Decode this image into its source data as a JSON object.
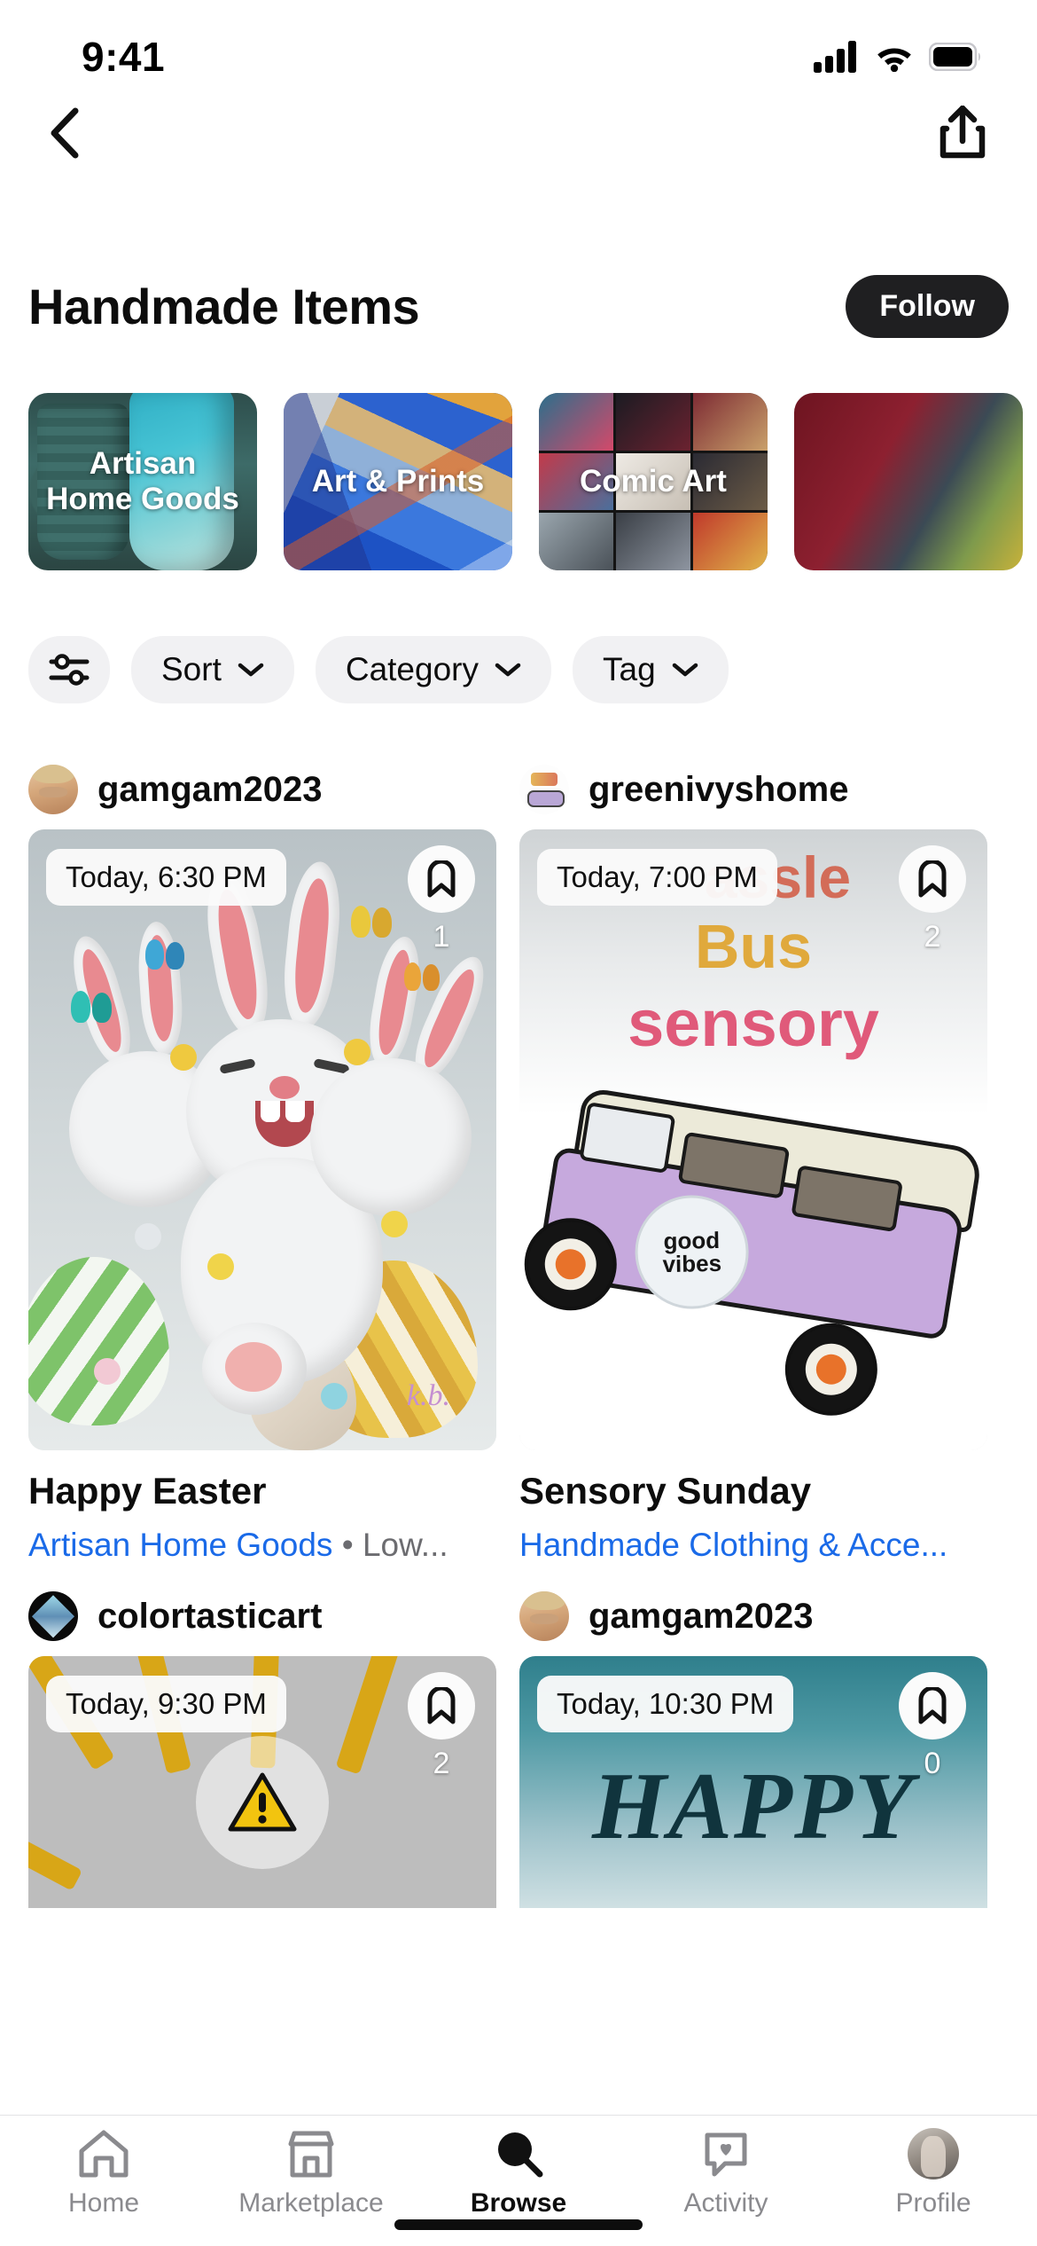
{
  "status_bar": {
    "time": "9:41",
    "cellular_icon": "cellular-bars-icon",
    "wifi_icon": "wifi-icon",
    "battery_icon": "battery-full-icon"
  },
  "nav": {
    "back_icon": "chevron-left-icon",
    "share_icon": "share-up-icon"
  },
  "header": {
    "title": "Handmade Items",
    "follow_label": "Follow"
  },
  "categories": [
    {
      "label": "Artisan\nHome Goods",
      "label_line1": "Artisan",
      "label_line2": "Home Goods",
      "art": "pottery"
    },
    {
      "label": "Art & Prints",
      "art": "paint"
    },
    {
      "label": "Comic Art",
      "art": "comic"
    },
    {
      "label": "",
      "art": "dark"
    }
  ],
  "filters": {
    "settings_icon": "sliders-icon",
    "chips": [
      {
        "label": "Sort",
        "chevron": "chevron-down-icon"
      },
      {
        "label": "Category",
        "chevron": "chevron-down-icon"
      },
      {
        "label": "Tag",
        "chevron": "chevron-down-icon"
      }
    ]
  },
  "feed": {
    "row1": [
      {
        "username": "gamgam2023",
        "avatar": "user-photo-avatar",
        "time_badge": "Today, 6:30 PM",
        "bookmark_icon": "bookmark-icon",
        "bookmark_count": "1",
        "title": "Happy Easter",
        "category_link": "Artisan Home Goods",
        "separator": "•",
        "extra": "Low...",
        "artwork_signature": "k.b."
      },
      {
        "username": "greenivyshome",
        "avatar": "bus-logo-avatar",
        "time_badge": "Today, 7:00 PM",
        "bookmark_icon": "bookmark-icon",
        "bookmark_count": "2",
        "title": "Sensory Sunday",
        "category_link": "Handmade Clothing & Acce...",
        "artwork_word1": "Bus",
        "artwork_word2": "sensory",
        "artwork_badge": "good vibes"
      }
    ],
    "row2": [
      {
        "username": "colortasticart",
        "avatar": "diamond-logo-avatar",
        "time_badge": "Today, 9:30 PM",
        "bookmark_icon": "bookmark-icon",
        "bookmark_count": "2",
        "artwork_icon": "warning-triangle-icon"
      },
      {
        "username": "gamgam2023",
        "avatar": "user-photo-avatar",
        "time_badge": "Today, 10:30 PM",
        "bookmark_icon": "bookmark-icon",
        "bookmark_count": "0",
        "artwork_text": "HAPPY"
      }
    ]
  },
  "tabbar": {
    "tabs": [
      {
        "label": "Home",
        "icon": "home-icon",
        "active": false
      },
      {
        "label": "Marketplace",
        "icon": "storefront-icon",
        "active": false
      },
      {
        "label": "Browse",
        "icon": "search-icon",
        "active": true
      },
      {
        "label": "Activity",
        "icon": "chat-heart-icon",
        "active": false
      },
      {
        "label": "Profile",
        "icon": "profile-avatar-icon",
        "active": false
      }
    ]
  },
  "colors": {
    "link_blue": "#1a6ae8",
    "follow_bg": "#1f1f21",
    "chip_bg": "#f1f1f3",
    "muted_text": "#6c6c70"
  }
}
